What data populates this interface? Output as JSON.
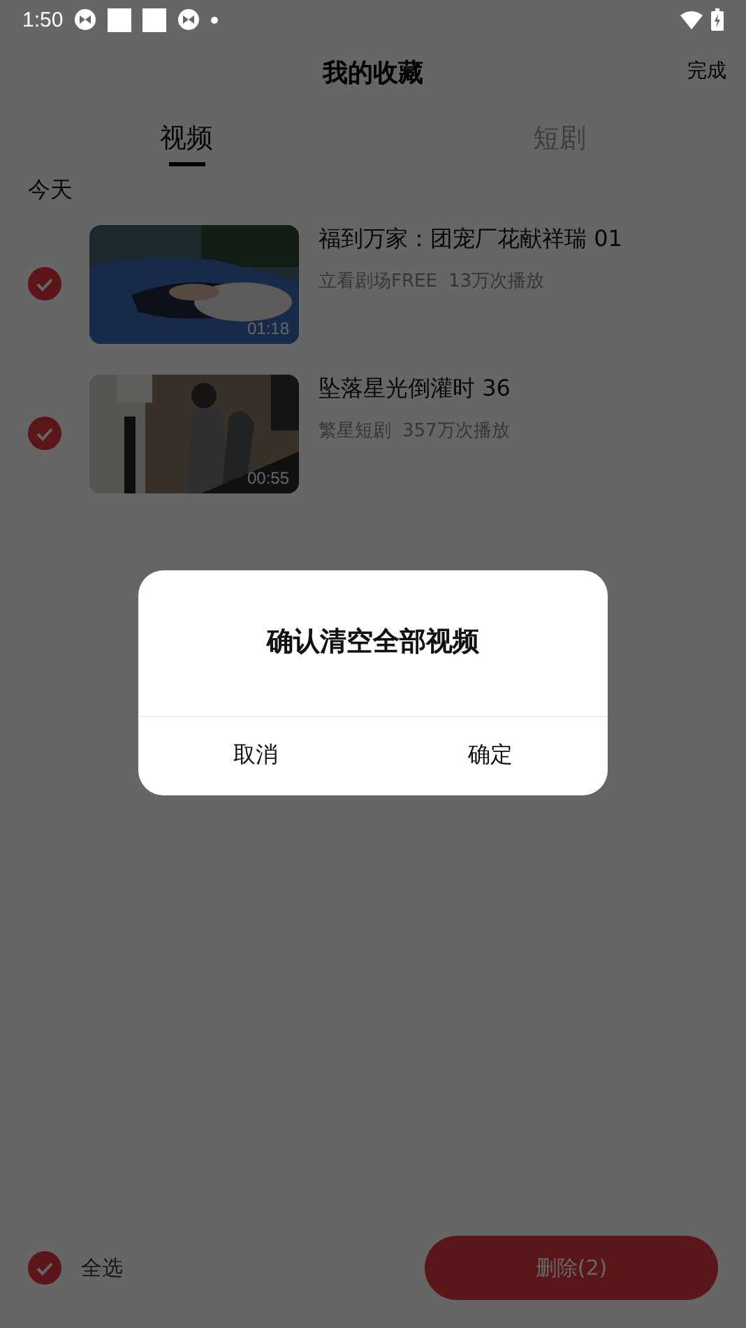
{
  "status_bar": {
    "time": "1:50"
  },
  "header": {
    "title": "我的收藏",
    "action": "完成"
  },
  "tabs": [
    {
      "label": "视频",
      "selected": true
    },
    {
      "label": "短剧",
      "selected": false
    }
  ],
  "section": "今天",
  "items": [
    {
      "checked": true,
      "kind": "picture",
      "duration": "01:18",
      "title": "福到万家：团宠厂花献祥瑞 01",
      "source": "立看剧场FREE",
      "plays": "13万次播放"
    },
    {
      "checked": true,
      "kind": "picture",
      "duration": "00:55",
      "title": "坠落星光倒灌时 36",
      "source": "繁星短剧",
      "plays": "357万次播放"
    }
  ],
  "footer": {
    "select_all": {
      "label": "全选",
      "checked": true
    },
    "delete_button": "删除(2)"
  },
  "dialog": {
    "message": "确认清空全部视频",
    "buttons": [
      "取消",
      "确定"
    ]
  }
}
